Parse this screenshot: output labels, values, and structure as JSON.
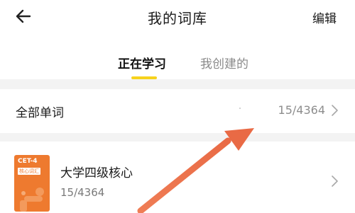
{
  "header": {
    "title": "我的词库",
    "edit_label": "编辑",
    "back_icon": "arrow-left-icon"
  },
  "tabs": [
    {
      "label": "正在学习",
      "active": true
    },
    {
      "label": "我创建的",
      "active": false
    }
  ],
  "all_words": {
    "label": "全部单词",
    "count": "15/4364"
  },
  "word_books": [
    {
      "cover_level": "CET-4",
      "cover_tag": "核心词汇",
      "title": "大学四级核心",
      "progress": "15/4364"
    }
  ],
  "colors": {
    "accent_yellow": "#f7d21c",
    "cover_orange": "#ee7a2f",
    "annotation_arrow": "#ec7550",
    "separator_gray": "#f3f3f3"
  }
}
